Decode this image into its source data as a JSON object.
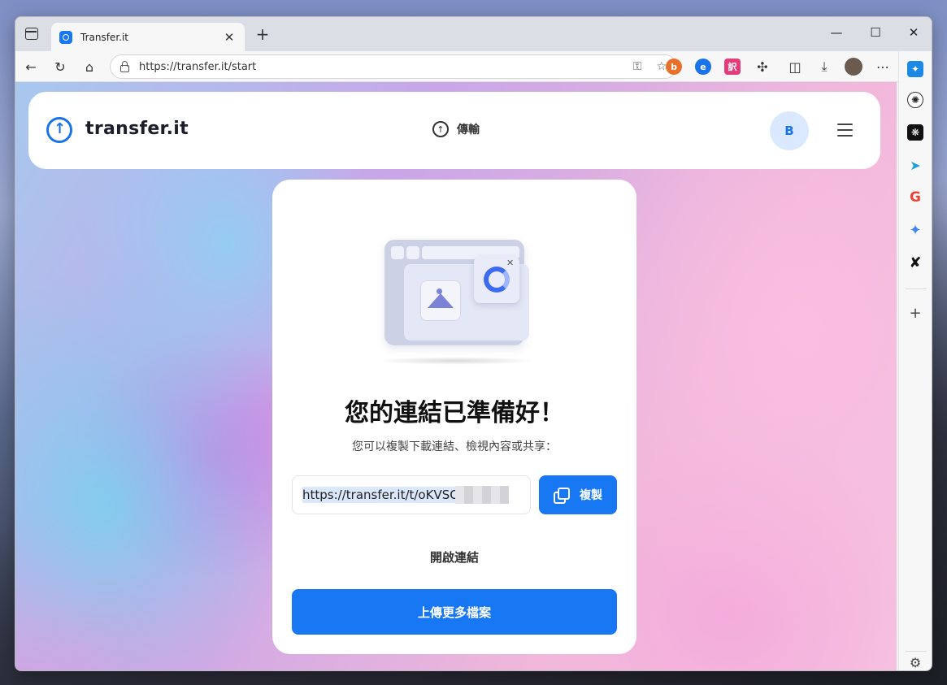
{
  "browser": {
    "tab_title": "Transfer.it",
    "tab_close": "✕",
    "new_tab": "+",
    "url": "https://transfer.it/start",
    "window_controls": {
      "minimize": "—",
      "maximize": "☐",
      "close": "✕"
    },
    "extension_colors": {
      "ext1": "#e8702a",
      "ext2": "#1a73e8",
      "ext3": "#e23c7a"
    },
    "extensions_text": {
      "ext3": "訳"
    },
    "more_menu": "⋯",
    "sidebar_icons": [
      "image-gen-icon",
      "openai-icon",
      "ai-brain-icon",
      "telegram-icon",
      "google-icon",
      "gemini-icon",
      "x-icon"
    ],
    "sidebar_add": "+",
    "sidebar_settings": "⚙"
  },
  "nav": {
    "logo_text": "transfer.it",
    "logo_arrow": "↑",
    "upload_label": "傳輸",
    "upload_icon": "↑",
    "avatar_letter": "B"
  },
  "card": {
    "title": "您的連結已準備好！",
    "subtitle": "您可以複製下載連結、檢視內容或共享：",
    "link_value": "https://transfer.it/t/oKVSQc",
    "copy_label": "複製",
    "open_link_label": "開啟連結",
    "upload_more_label": "上傳更多檔案",
    "illustration_close": "✕"
  },
  "colors": {
    "accent": "#1877f2",
    "avatar_bg": "#dbe9ff"
  }
}
